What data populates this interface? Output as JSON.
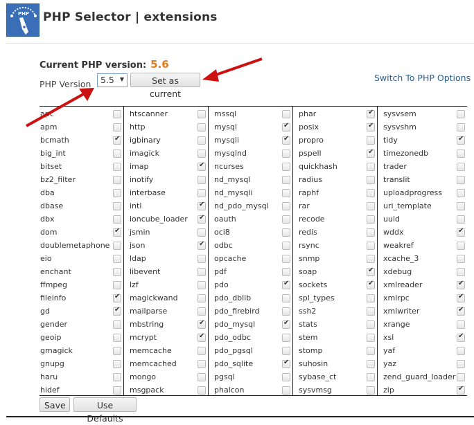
{
  "header": {
    "logo_icon": "php-selector-logo-icon",
    "logo_text": "PHP",
    "title": "PHP Selector | extensions"
  },
  "current_version": {
    "label": "Current PHP version:",
    "value": "5.6"
  },
  "version_selector": {
    "label": "PHP Version",
    "selected": "5.5",
    "set_button": "Set as current"
  },
  "switch_link": "Switch To PHP Options",
  "extensions": {
    "columns": [
      [
        {
          "name": "apc",
          "checked": false
        },
        {
          "name": "apm",
          "checked": false
        },
        {
          "name": "bcmath",
          "checked": true
        },
        {
          "name": "big_int",
          "checked": false
        },
        {
          "name": "bitset",
          "checked": false
        },
        {
          "name": "bz2_filter",
          "checked": false
        },
        {
          "name": "dba",
          "checked": false
        },
        {
          "name": "dbase",
          "checked": false
        },
        {
          "name": "dbx",
          "checked": false
        },
        {
          "name": "dom",
          "checked": true
        },
        {
          "name": "doublemetaphone",
          "checked": false
        },
        {
          "name": "eio",
          "checked": false
        },
        {
          "name": "enchant",
          "checked": false
        },
        {
          "name": "ffmpeg",
          "checked": false
        },
        {
          "name": "fileinfo",
          "checked": true
        },
        {
          "name": "gd",
          "checked": true
        },
        {
          "name": "gender",
          "checked": false
        },
        {
          "name": "geoip",
          "checked": false
        },
        {
          "name": "gmagick",
          "checked": false
        },
        {
          "name": "gnupg",
          "checked": false
        },
        {
          "name": "haru",
          "checked": false
        },
        {
          "name": "hidef",
          "checked": false
        }
      ],
      [
        {
          "name": "htscanner",
          "checked": false
        },
        {
          "name": "http",
          "checked": false
        },
        {
          "name": "igbinary",
          "checked": false
        },
        {
          "name": "imagick",
          "checked": false
        },
        {
          "name": "imap",
          "checked": true
        },
        {
          "name": "inotify",
          "checked": false
        },
        {
          "name": "interbase",
          "checked": false
        },
        {
          "name": "intl",
          "checked": true
        },
        {
          "name": "ioncube_loader",
          "checked": true
        },
        {
          "name": "jsmin",
          "checked": false
        },
        {
          "name": "json",
          "checked": true
        },
        {
          "name": "ldap",
          "checked": false
        },
        {
          "name": "libevent",
          "checked": false
        },
        {
          "name": "lzf",
          "checked": false
        },
        {
          "name": "magickwand",
          "checked": false
        },
        {
          "name": "mailparse",
          "checked": false
        },
        {
          "name": "mbstring",
          "checked": true
        },
        {
          "name": "mcrypt",
          "checked": true
        },
        {
          "name": "memcache",
          "checked": false
        },
        {
          "name": "memcached",
          "checked": false
        },
        {
          "name": "mongo",
          "checked": false
        },
        {
          "name": "msgpack",
          "checked": false
        }
      ],
      [
        {
          "name": "mssql",
          "checked": false
        },
        {
          "name": "mysql",
          "checked": true
        },
        {
          "name": "mysqli",
          "checked": true
        },
        {
          "name": "mysqlnd",
          "checked": false
        },
        {
          "name": "ncurses",
          "checked": false
        },
        {
          "name": "nd_mysql",
          "checked": false
        },
        {
          "name": "nd_mysqli",
          "checked": false
        },
        {
          "name": "nd_pdo_mysql",
          "checked": false
        },
        {
          "name": "oauth",
          "checked": false
        },
        {
          "name": "oci8",
          "checked": false
        },
        {
          "name": "odbc",
          "checked": false
        },
        {
          "name": "opcache",
          "checked": false
        },
        {
          "name": "pdf",
          "checked": false
        },
        {
          "name": "pdo",
          "checked": true
        },
        {
          "name": "pdo_dblib",
          "checked": false
        },
        {
          "name": "pdo_firebird",
          "checked": false
        },
        {
          "name": "pdo_mysql",
          "checked": true
        },
        {
          "name": "pdo_odbc",
          "checked": false
        },
        {
          "name": "pdo_pgsql",
          "checked": false
        },
        {
          "name": "pdo_sqlite",
          "checked": true
        },
        {
          "name": "pgsql",
          "checked": false
        },
        {
          "name": "phalcon",
          "checked": false
        }
      ],
      [
        {
          "name": "phar",
          "checked": true
        },
        {
          "name": "posix",
          "checked": true
        },
        {
          "name": "propro",
          "checked": false
        },
        {
          "name": "pspell",
          "checked": true
        },
        {
          "name": "quickhash",
          "checked": false
        },
        {
          "name": "radius",
          "checked": false
        },
        {
          "name": "raphf",
          "checked": false
        },
        {
          "name": "rar",
          "checked": false
        },
        {
          "name": "recode",
          "checked": false
        },
        {
          "name": "redis",
          "checked": false
        },
        {
          "name": "rsync",
          "checked": false
        },
        {
          "name": "snmp",
          "checked": false
        },
        {
          "name": "soap",
          "checked": true
        },
        {
          "name": "sockets",
          "checked": true
        },
        {
          "name": "spl_types",
          "checked": false
        },
        {
          "name": "ssh2",
          "checked": false
        },
        {
          "name": "stats",
          "checked": false
        },
        {
          "name": "stem",
          "checked": false
        },
        {
          "name": "stomp",
          "checked": false
        },
        {
          "name": "suhosin",
          "checked": false
        },
        {
          "name": "sybase_ct",
          "checked": false
        },
        {
          "name": "sysvmsg",
          "checked": false
        }
      ],
      [
        {
          "name": "sysvsem",
          "checked": false
        },
        {
          "name": "sysvshm",
          "checked": false
        },
        {
          "name": "tidy",
          "checked": true
        },
        {
          "name": "timezonedb",
          "checked": false
        },
        {
          "name": "trader",
          "checked": false
        },
        {
          "name": "translit",
          "checked": false
        },
        {
          "name": "uploadprogress",
          "checked": false
        },
        {
          "name": "uri_template",
          "checked": false
        },
        {
          "name": "uuid",
          "checked": false
        },
        {
          "name": "wddx",
          "checked": true
        },
        {
          "name": "weakref",
          "checked": false
        },
        {
          "name": "xcache_3",
          "checked": false
        },
        {
          "name": "xdebug",
          "checked": false
        },
        {
          "name": "xmlreader",
          "checked": true
        },
        {
          "name": "xmlrpc",
          "checked": true
        },
        {
          "name": "xmlwriter",
          "checked": true
        },
        {
          "name": "xrange",
          "checked": false
        },
        {
          "name": "xsl",
          "checked": true
        },
        {
          "name": "yaf",
          "checked": false
        },
        {
          "name": "yaz",
          "checked": false
        },
        {
          "name": "zend_guard_loader",
          "checked": false
        },
        {
          "name": "zip",
          "checked": true
        }
      ]
    ]
  },
  "footer": {
    "save_label": "Save",
    "defaults_label": "Use Defaults"
  },
  "colors": {
    "current_version_value": "#e07b1a",
    "annotation_arrow": "#cc1111",
    "logo_bg": "#3a6fb8"
  }
}
